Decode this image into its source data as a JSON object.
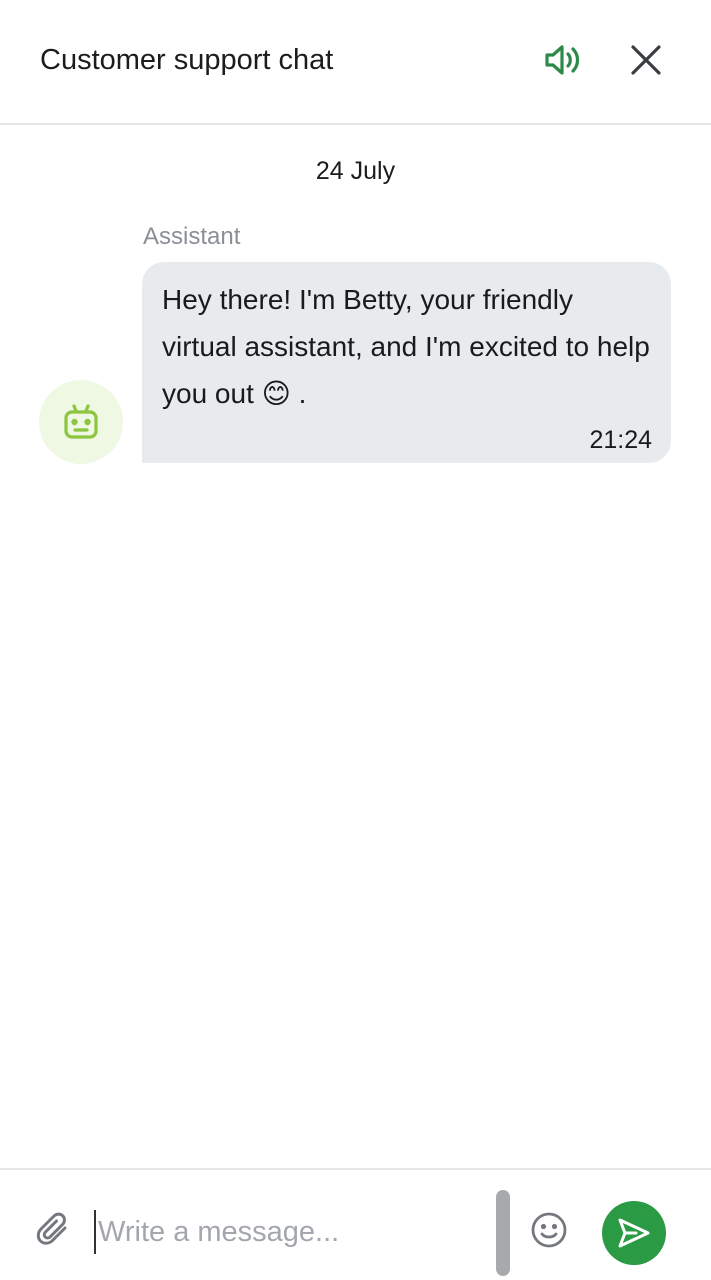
{
  "header": {
    "title": "Customer support chat",
    "sound_icon": "speaker-icon",
    "close_icon": "close-icon"
  },
  "chat": {
    "date": "24 July",
    "messages": [
      {
        "sender": "Assistant",
        "avatar_icon": "robot-icon",
        "text": "Hey there! I'm Betty, your friendly virtual assistant, and I'm excited to help you out 😊 .",
        "time": "21:24"
      }
    ]
  },
  "composer": {
    "placeholder": "Write a message...",
    "value": "",
    "attach_icon": "paperclip-icon",
    "emoji_icon": "smiley-icon",
    "send_icon": "send-icon"
  },
  "colors": {
    "accent": "#2b9a45",
    "avatar_bg": "#eef8e2",
    "robot_icon": "#8cc53f",
    "bubble_bg": "#e8ebee",
    "divider": "#e3e5e8",
    "muted_text": "#8a8f96"
  }
}
